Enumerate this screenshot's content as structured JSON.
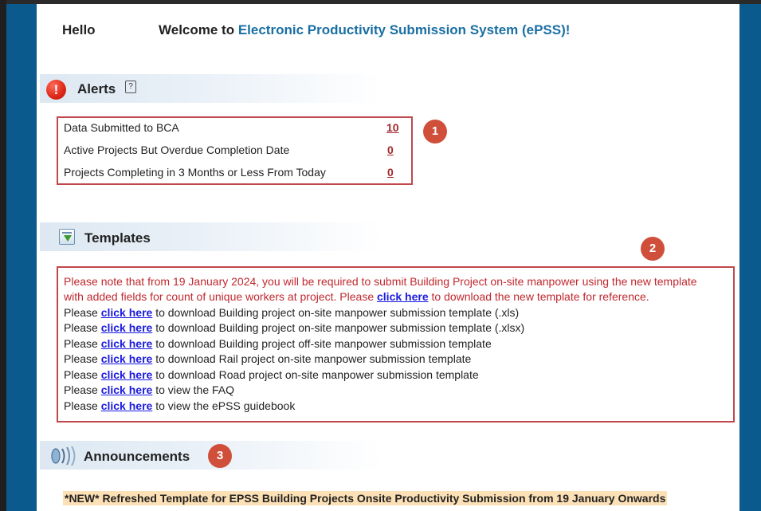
{
  "header": {
    "hello": "Hello",
    "welcome_prefix": "Welcome to ",
    "system_name": "Electronic Productivity Submission System (ePSS)!"
  },
  "alerts": {
    "title": "Alerts",
    "help_glyph": "?",
    "items": [
      {
        "label": "Data Submitted to BCA",
        "count": "10"
      },
      {
        "label": "Active Projects But Overdue Completion Date",
        "count": "0"
      },
      {
        "label": "Projects Completing in 3 Months or Less From Today",
        "count": "0"
      }
    ]
  },
  "templates": {
    "title": "Templates",
    "notice_line1": "Please note that from 19 January 2024, you will be required to submit Building Project on-site manpower using the new template",
    "notice_line2_prefix": "with added fields for count of unique workers at project. Please ",
    "notice_link": "click here",
    "notice_line2_suffix": " to download the new template for reference.",
    "please": "Please ",
    "link_text": "click here",
    "items": [
      " to download Building project on-site manpower submission template (.xls)",
      " to download Building project on-site manpower submission template (.xlsx)",
      " to download Building project off-site manpower submission template",
      " to download Rail project on-site manpower submission template",
      " to download Road project on-site manpower submission template",
      " to view the FAQ",
      " to view the ePSS guidebook"
    ]
  },
  "announcements": {
    "title": "Announcements",
    "headline": "*NEW* Refreshed Template for EPSS Building Projects Onsite Productivity Submission from 19 January Onwards"
  },
  "badges": [
    "1",
    "2",
    "3"
  ],
  "icons": {
    "alerts": "exclamation-icon",
    "help": "help-icon",
    "templates": "download-template-icon",
    "announcements": "speaker-icon"
  },
  "colors": {
    "side_panel": "#0b5a8e",
    "system_name": "#1a6fa3",
    "highlight_box": "#c0484c",
    "badge": "#cf4f3a",
    "link": "#1a1ae0",
    "count_link": "#a0282e",
    "notice_text": "#c0282e",
    "headline_bg": "#fde1b6"
  }
}
